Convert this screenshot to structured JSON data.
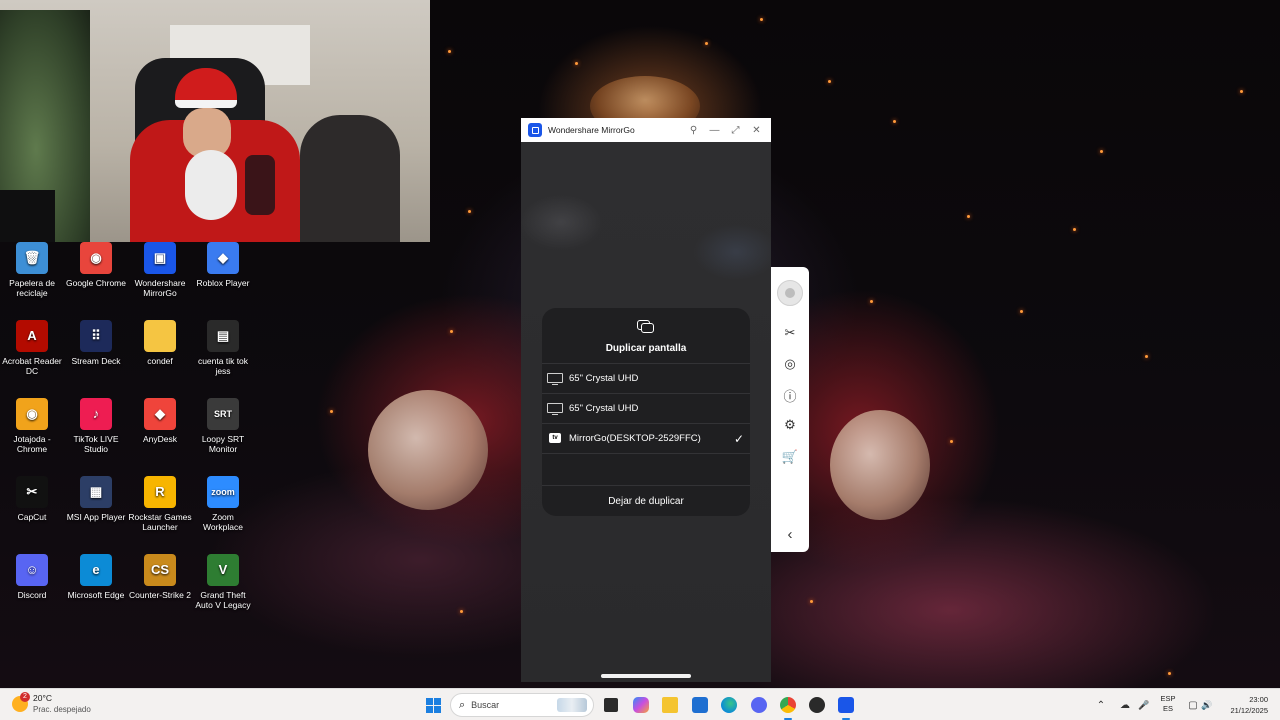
{
  "desktop": {
    "icons": [
      {
        "label": "Papelera de reciclaje",
        "glyph": "🗑",
        "color": "#3d8fd6"
      },
      {
        "label": "Google Chrome",
        "glyph": "◉",
        "color": "#e8453c"
      },
      {
        "label": "Wondershare MirrorGo",
        "glyph": "▣",
        "color": "#1a56e8"
      },
      {
        "label": "Roblox Player",
        "glyph": "◆",
        "color": "#3a7bf0"
      },
      {
        "label": "Acrobat Reader DC",
        "glyph": "A",
        "color": "#b30b00"
      },
      {
        "label": "Stream Deck",
        "glyph": "⠿",
        "color": "#1d2a5a"
      },
      {
        "label": "condef",
        "glyph": "",
        "color": "#f5c542"
      },
      {
        "label": "cuenta tik tok jess",
        "glyph": "▤",
        "color": "#2a2a2a"
      },
      {
        "label": "Jotajoda - Chrome",
        "glyph": "◉",
        "color": "#f1a31b"
      },
      {
        "label": "TikTok LIVE Studio",
        "glyph": "♪",
        "color": "#ee1d52"
      },
      {
        "label": "AnyDesk",
        "glyph": "◆",
        "color": "#ef443b"
      },
      {
        "label": "Loopy SRT Monitor",
        "glyph": "SRT",
        "color": "#3a3a3a"
      },
      {
        "label": "CapCut",
        "glyph": "✂",
        "color": "#111111"
      },
      {
        "label": "MSI App Player",
        "glyph": "▦",
        "color": "#2c3e66"
      },
      {
        "label": "Rockstar Games Launcher",
        "glyph": "R",
        "color": "#f7b500"
      },
      {
        "label": "Zoom Workplace",
        "glyph": "zoom",
        "color": "#2d8cff"
      },
      {
        "label": "Discord",
        "glyph": "☺",
        "color": "#5865f2"
      },
      {
        "label": "Microsoft Edge",
        "glyph": "e",
        "color": "#0c8bd6"
      },
      {
        "label": "Counter-Strike 2",
        "glyph": "CS",
        "color": "#c98a1c"
      },
      {
        "label": "Grand Theft Auto V Legacy",
        "glyph": "V",
        "color": "#2e7d32"
      }
    ]
  },
  "mirrorgo": {
    "title": "Wondershare MirrorGo",
    "controls": {
      "pin": "⚲",
      "minimize": "—",
      "maximize": "⤢",
      "close": "✕"
    },
    "panel": {
      "title": "Duplicar pantalla",
      "devices": [
        {
          "name": "65\" Crystal UHD",
          "type": "tv",
          "selected": false
        },
        {
          "name": "65\" Crystal UHD",
          "type": "tv",
          "selected": false
        },
        {
          "name": "MirrorGo(DESKTOP-2529FFC)",
          "type": "appletv",
          "selected": true
        }
      ],
      "check_glyph": "✓",
      "appletv_glyph": "tv",
      "stop_label": "Dejar de duplicar"
    }
  },
  "toolbar": {
    "items": [
      {
        "name": "scissors-icon",
        "glyph": "✂"
      },
      {
        "name": "record-icon",
        "glyph": "◎"
      },
      {
        "name": "alert-icon",
        "glyph": "ⓘ"
      },
      {
        "name": "settings-icon",
        "glyph": "⚙"
      },
      {
        "name": "cart-icon",
        "glyph": "🛒"
      }
    ],
    "collapse_glyph": "‹"
  },
  "taskbar": {
    "weather": {
      "temp": "20°C",
      "condition": "Prac. despejado",
      "badge": "2"
    },
    "search_placeholder": "Buscar",
    "search_glyph": "⌕",
    "language": {
      "code": "ESP",
      "region": "ES"
    },
    "clock": {
      "time": "23:00",
      "date": "21/12/2025"
    },
    "tray": {
      "chevron": "⌃",
      "wifi": "☁",
      "mic": "🎤",
      "notif": "▢",
      "volume": "🔊"
    }
  },
  "colors": {
    "accent": "#1b7fe0",
    "mirrorgo_brand": "#1a56e8",
    "panel_bg": "#1f1f21"
  }
}
